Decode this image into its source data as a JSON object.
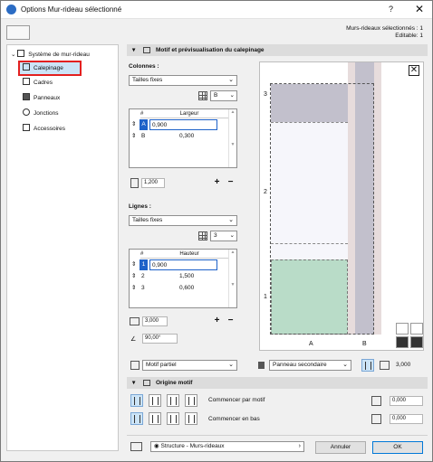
{
  "window": {
    "title": "Options Mur-rideau sélectionné",
    "help": "?",
    "close": "✕"
  },
  "info": {
    "selected": "Murs-rideaux sélectionnés : 1",
    "editable": "Editable: 1"
  },
  "sidebar": {
    "root": "Système de mur-rideau",
    "items": [
      {
        "label": "Calepinage",
        "selected": true
      },
      {
        "label": "Cadres"
      },
      {
        "label": "Panneaux"
      },
      {
        "label": "Jonctions"
      },
      {
        "label": "Accessoires"
      }
    ]
  },
  "section1": {
    "title": "Motif et prévisualisation du calepinage"
  },
  "columns": {
    "label": "Colonnes :",
    "mode": "Tailles fixes",
    "count": "B",
    "header_idx": "#",
    "header_val": "Largeur",
    "rows": [
      {
        "mark": "⇕",
        "idx": "A",
        "val": "0,900"
      },
      {
        "mark": "⇕",
        "idx": "B",
        "val": "0,300"
      }
    ],
    "total": "1,200"
  },
  "lines": {
    "label": "Lignes :",
    "mode": "Tailles fixes",
    "count": "3",
    "header_idx": "#",
    "header_val": "Hauteur",
    "rows": [
      {
        "mark": "⇕",
        "idx": "1",
        "val": "0,900"
      },
      {
        "mark": "⇕",
        "idx": "2",
        "val": "1,500"
      },
      {
        "mark": "⇕",
        "idx": "3",
        "val": "0,600"
      }
    ],
    "total": "3,000",
    "angle": "90,00°"
  },
  "preview": {
    "row_labels": [
      "3",
      "2",
      "1"
    ],
    "col_labels": [
      "A",
      "B"
    ],
    "colors": {
      "grey": "#c2c0cc",
      "white": "#f6f6fb",
      "green": "#b9dcc8",
      "mullion": "#e7dcdc"
    }
  },
  "motif_bar": {
    "motif": "Motif partiel",
    "panel": "Panneau secondaire",
    "value": "3,000"
  },
  "section2": {
    "title": "Origine motif"
  },
  "origin": {
    "per_motif": "Commencer par motif",
    "bottom": "Commencer en bas",
    "x": "0,000",
    "y": "0,000"
  },
  "footer": {
    "structure": "Structure - Murs-rideaux",
    "cancel": "Annuler",
    "ok": "OK"
  }
}
